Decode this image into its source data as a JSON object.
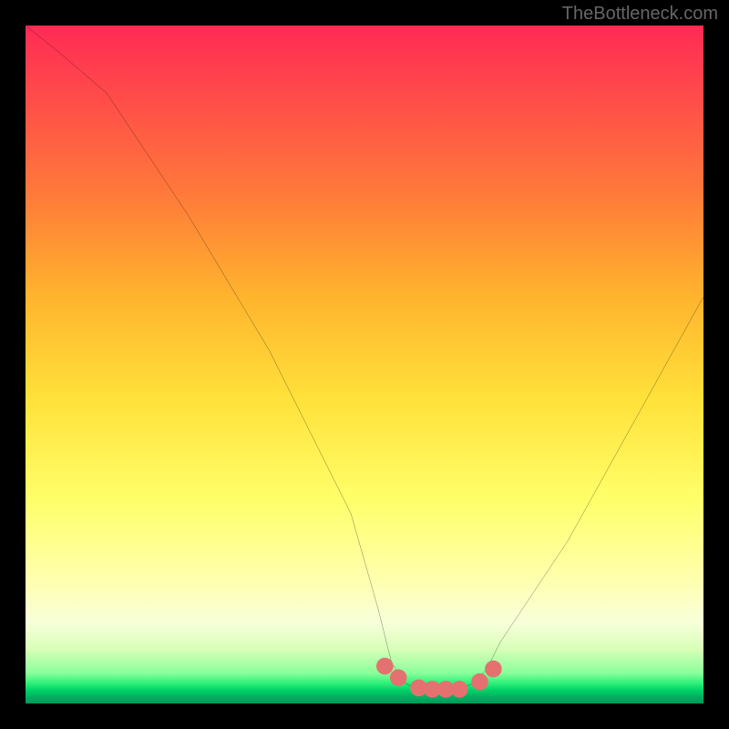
{
  "watermark": "TheBottleneck.com",
  "chart_data": {
    "type": "line",
    "title": "",
    "xlabel": "",
    "ylabel": "",
    "xlim": [
      0,
      100
    ],
    "ylim": [
      0,
      100
    ],
    "series": [
      {
        "name": "bottleneck-curve",
        "x": [
          0,
          5,
          12,
          24,
          36,
          48,
          52,
          54,
          56,
          58,
          60,
          62,
          64,
          66,
          68,
          70,
          80,
          90,
          100
        ],
        "y": [
          100,
          96,
          90,
          72,
          52,
          28,
          14,
          6,
          3,
          2,
          1.5,
          1.5,
          2,
          3,
          5,
          9,
          24,
          42,
          60
        ]
      }
    ],
    "markers": {
      "name": "highlight-points",
      "color": "#e4716f",
      "x": [
        53,
        55,
        58,
        60,
        62,
        64,
        67,
        69
      ],
      "y": [
        5.5,
        3.8,
        2.3,
        2.1,
        2.1,
        2.1,
        3.2,
        5.1
      ]
    },
    "background_gradient_stops": [
      {
        "pos": 0.0,
        "color": "#ff2a55"
      },
      {
        "pos": 0.25,
        "color": "#ff7a3a"
      },
      {
        "pos": 0.55,
        "color": "#ffe13a"
      },
      {
        "pos": 0.82,
        "color": "#ffffb0"
      },
      {
        "pos": 0.95,
        "color": "#8aff9a"
      },
      {
        "pos": 1.0,
        "color": "#009858"
      }
    ]
  }
}
